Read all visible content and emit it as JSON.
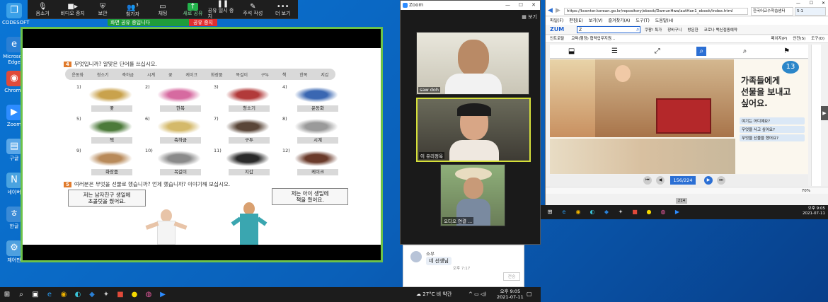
{
  "desktop": {
    "icons": [
      {
        "label": "CODESOFT",
        "glyph": "❒",
        "color": "#3aa0e8"
      },
      {
        "label": "Microsoft Edge",
        "glyph": "e",
        "color": "#2a7fd4"
      },
      {
        "label": "Chrome",
        "glyph": "◉",
        "color": "#e04a3a"
      },
      {
        "label": "Zoom",
        "glyph": "▶",
        "color": "#2d8cff"
      },
      {
        "label": "구글",
        "glyph": "▤",
        "color": "#5aa7e8"
      },
      {
        "label": "네이버",
        "glyph": "N",
        "color": "#4aa3e0"
      },
      {
        "label": "한글",
        "glyph": "ㅎ",
        "color": "#3a8ad6"
      },
      {
        "label": "제어판",
        "glyph": "⚙",
        "color": "#4fa0df"
      }
    ]
  },
  "zoom_toolbar": {
    "mute": "음소거",
    "video_stop": "비디오 중지",
    "security": "보안",
    "participants": "참가자",
    "participants_count": "3",
    "chat": "채팅",
    "new_share": "새로 공유",
    "pause_share": "공유 일시 중지",
    "annotate": "주석 작성",
    "more": "더 보기",
    "sharing_status": "화면 공유 중입니다",
    "stop_share": "공유 중지"
  },
  "worksheet": {
    "section4_num": "4",
    "section4_title": "무엇입니까? 알맞은 단어를 쓰십시오.",
    "wordbank": [
      "운동화",
      "청소기",
      "축하금",
      "시계",
      "꽃",
      "케이크",
      "화장품",
      "목걸이",
      "구두",
      "책",
      "한복",
      "지갑"
    ],
    "items": [
      {
        "num": "1)",
        "label": "꽃",
        "color": "#c9a24c"
      },
      {
        "num": "2)",
        "label": "한복",
        "color": "#d66aa0"
      },
      {
        "num": "3)",
        "label": "청소기",
        "color": "#b23a3a"
      },
      {
        "num": "4)",
        "label": "운동화",
        "color": "#3a67b2"
      },
      {
        "num": "5)",
        "label": "책",
        "color": "#4c7a3a"
      },
      {
        "num": "6)",
        "label": "축하금",
        "color": "#d4b96a"
      },
      {
        "num": "7)",
        "label": "구두",
        "color": "#5a4638"
      },
      {
        "num": "8)",
        "label": "시계",
        "color": "#9a9a9a"
      },
      {
        "num": "9)",
        "label": "화장품",
        "color": "#b88a5a"
      },
      {
        "num": "10)",
        "label": "목걸이",
        "color": "#8a8a8a"
      },
      {
        "num": "11)",
        "label": "지갑",
        "color": "#2a2a2a"
      },
      {
        "num": "12)",
        "label": "케이크",
        "color": "#6a3a2a"
      }
    ],
    "section5_num": "5",
    "section5_title": "여러분은 무엇을 선물로 했습니까? 언제 했습니까? 이야기해 보십시오.",
    "bubble1": "저는 남자친구 생일에\n초콜릿을 줬어요.",
    "bubble2": "저는 아이 생일에\n책을 줬어요."
  },
  "zoom_gallery": {
    "title": "Zoom",
    "view": "보기",
    "participants": [
      {
        "name": "saw doh"
      },
      {
        "name": "이 유리정옥"
      },
      {
        "name": "오디오 연결 ..."
      }
    ]
  },
  "chat": {
    "sender": "쇼무",
    "message": "네 선생님",
    "time": "오후 7:17",
    "send": "전송"
  },
  "browser": {
    "tab_title": "한국어교수학습샘터",
    "tab2_title": "5-1",
    "url": "https://kcenter.korean.go.kr/repository/ebook/DamunHwa/autHan1_ebook/index.html",
    "menu": [
      "파일(F)",
      "편집(E)",
      "보기(V)",
      "즐겨찾기(A)",
      "도구(T)",
      "도움말(H)"
    ],
    "search_brand": "ZUM",
    "search_value": "Z",
    "fav_items": [
      "쿠팡! 특가",
      "장바구니",
      "방문한",
      "코로나 백신접종예약"
    ],
    "fav2_items": [
      "인트로탈",
      "교육(행정) 협력업무지원..."
    ],
    "cmd_items": [
      "페이지(P)",
      "안전(S)",
      "도구(O)"
    ],
    "ebook_heading": "가족들에게\n선물을 보내고\n싶어요.",
    "page_number": "13",
    "page_display": "156/224",
    "panel_items": [
      "여기는 어디예요?",
      "무엇을 사고 싶어요?",
      "무엇을 선물을 했어요?"
    ],
    "zoom_level": "70%"
  },
  "taskbar": {
    "weather": "27°C 비 약간",
    "time": "오후 9:05",
    "date": "2021-07-11"
  },
  "taskbar2": {
    "time": "오후 9:05",
    "date": "2021-07-11",
    "zoom_label": "214"
  }
}
